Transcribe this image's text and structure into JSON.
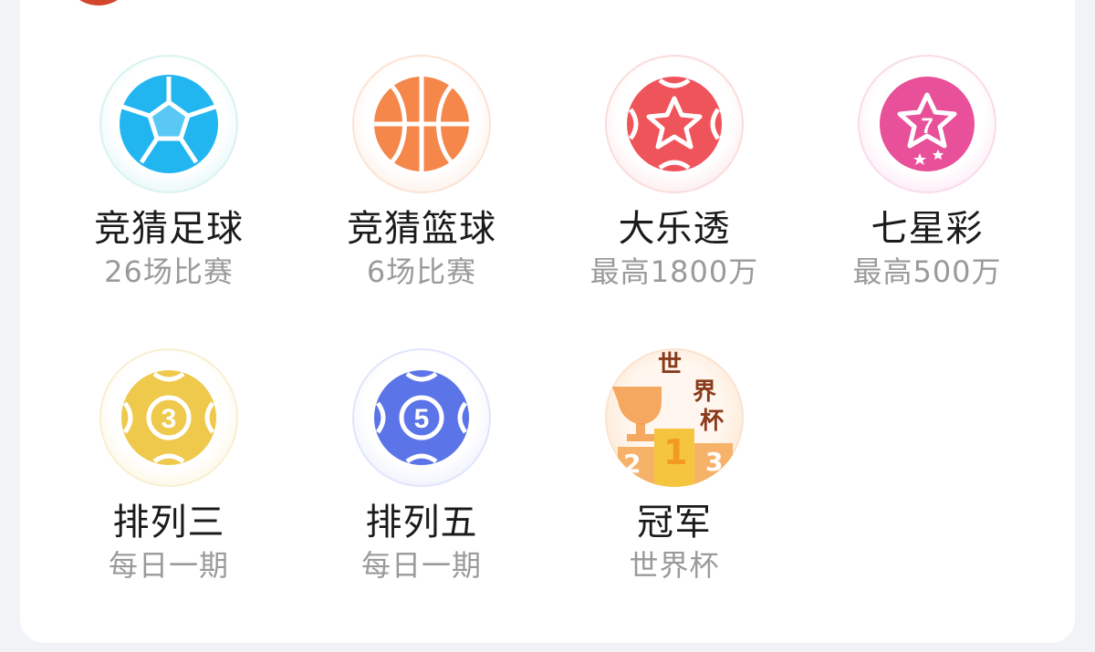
{
  "lottery_grid": {
    "items": [
      {
        "id": "football",
        "label": "竞猜足球",
        "sub": "26场比赛",
        "icon": "soccer-ball-icon"
      },
      {
        "id": "basketball",
        "label": "竞猜篮球",
        "sub": "6场比赛",
        "icon": "basketball-icon"
      },
      {
        "id": "dlt",
        "label": "大乐透",
        "sub": "最高1800万",
        "icon": "star-ball-icon"
      },
      {
        "id": "qxc",
        "label": "七星彩",
        "sub": "最高500万",
        "icon": "seven-star-icon"
      },
      {
        "id": "pl3",
        "label": "排列三",
        "sub": "每日一期",
        "icon": "number-3-ball-icon"
      },
      {
        "id": "pl5",
        "label": "排列五",
        "sub": "每日一期",
        "icon": "number-5-ball-icon"
      },
      {
        "id": "champion",
        "label": "冠军",
        "sub": "世界杯",
        "icon": "trophy-podium-icon"
      }
    ],
    "champion_badge_text": {
      "line1": "世",
      "line2": "界",
      "line3": "杯",
      "podium_left": "2",
      "podium_center": "1",
      "podium_right": "3"
    }
  },
  "colors": {
    "football": "#1fb4ee",
    "basketball": "#f4864a",
    "dlt": "#f0535a",
    "qxc": "#e9509a",
    "pl3": "#efc94c",
    "pl5": "#5b74e8",
    "champion": "#f39a47"
  }
}
